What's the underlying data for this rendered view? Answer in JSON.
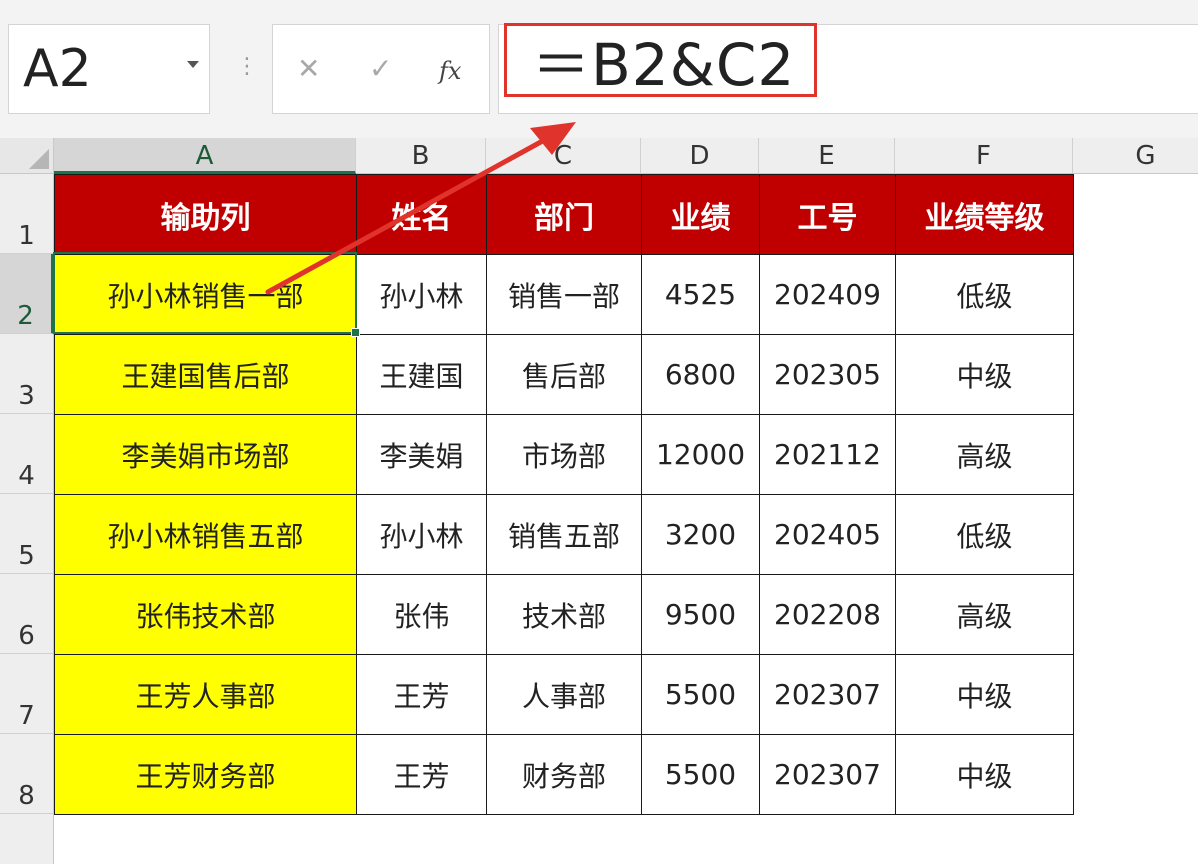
{
  "formula_bar": {
    "name_box": "A2",
    "cancel_icon": "✕",
    "enter_icon": "✓",
    "fx_label": "fx",
    "formula": "＝B2&C2"
  },
  "columns": [
    "A",
    "B",
    "C",
    "D",
    "E",
    "F",
    "G"
  ],
  "rows": [
    "1",
    "2",
    "3",
    "4",
    "5",
    "6",
    "7",
    "8"
  ],
  "table": {
    "headers": [
      "输助列",
      "姓名",
      "部门",
      "业绩",
      "工号",
      "业绩等级"
    ],
    "rows": [
      [
        "孙小林销售一部",
        "孙小林",
        "销售一部",
        "4525",
        "202409",
        "低级"
      ],
      [
        "王建国售后部",
        "王建国",
        "售后部",
        "6800",
        "202305",
        "中级"
      ],
      [
        "李美娟市场部",
        "李美娟",
        "市场部",
        "12000",
        "202112",
        "高级"
      ],
      [
        "孙小林销售五部",
        "孙小林",
        "销售五部",
        "3200",
        "202405",
        "低级"
      ],
      [
        "张伟技术部",
        "张伟",
        "技术部",
        "9500",
        "202208",
        "高级"
      ],
      [
        "王芳人事部",
        "王芳",
        "人事部",
        "5500",
        "202307",
        "中级"
      ],
      [
        "王芳财务部",
        "王芳",
        "财务部",
        "5500",
        "202307",
        "中级"
      ]
    ]
  },
  "colors": {
    "header_fill": "#c00000",
    "helper_fill": "#ffff00",
    "selection": "#217346",
    "annotation": "#e0332b"
  },
  "icons": [
    "dropdown-arrow-icon",
    "cancel-icon",
    "enter-icon",
    "fx-icon",
    "select-all-icon",
    "annotation-arrow"
  ]
}
